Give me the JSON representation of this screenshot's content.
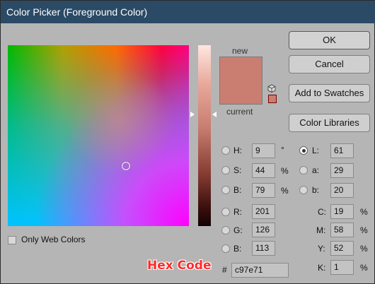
{
  "window": {
    "title": "Color Picker (Foreground Color)"
  },
  "preview": {
    "new_label": "new",
    "current_label": "current",
    "color": "#c97e71"
  },
  "buttons": {
    "ok": "OK",
    "cancel": "Cancel",
    "add_to_swatches": "Add to Swatches",
    "color_libraries": "Color Libraries"
  },
  "fields": {
    "H": {
      "label": "H:",
      "value": "9",
      "unit": "°"
    },
    "S": {
      "label": "S:",
      "value": "44",
      "unit": "%"
    },
    "Bri": {
      "label": "B:",
      "value": "79",
      "unit": "%"
    },
    "R": {
      "label": "R:",
      "value": "201"
    },
    "G": {
      "label": "G:",
      "value": "126"
    },
    "Blu": {
      "label": "B:",
      "value": "113"
    },
    "L": {
      "label": "L:",
      "value": "61"
    },
    "a": {
      "label": "a:",
      "value": "29"
    },
    "b": {
      "label": "b:",
      "value": "20"
    },
    "C": {
      "label": "C:",
      "value": "19",
      "unit": "%"
    },
    "M": {
      "label": "M:",
      "value": "58",
      "unit": "%"
    },
    "Y": {
      "label": "Y:",
      "value": "52",
      "unit": "%"
    },
    "K": {
      "label": "K:",
      "value": "1",
      "unit": "%"
    }
  },
  "web_colors": {
    "label": "Only Web Colors",
    "checked": false
  },
  "hex": {
    "prefix": "#",
    "value": "c97e71",
    "annotation": "Hex Code"
  },
  "icons": {
    "gamut_warning": "cube-icon",
    "web_safe_swatch": "web-safe-swatch"
  }
}
